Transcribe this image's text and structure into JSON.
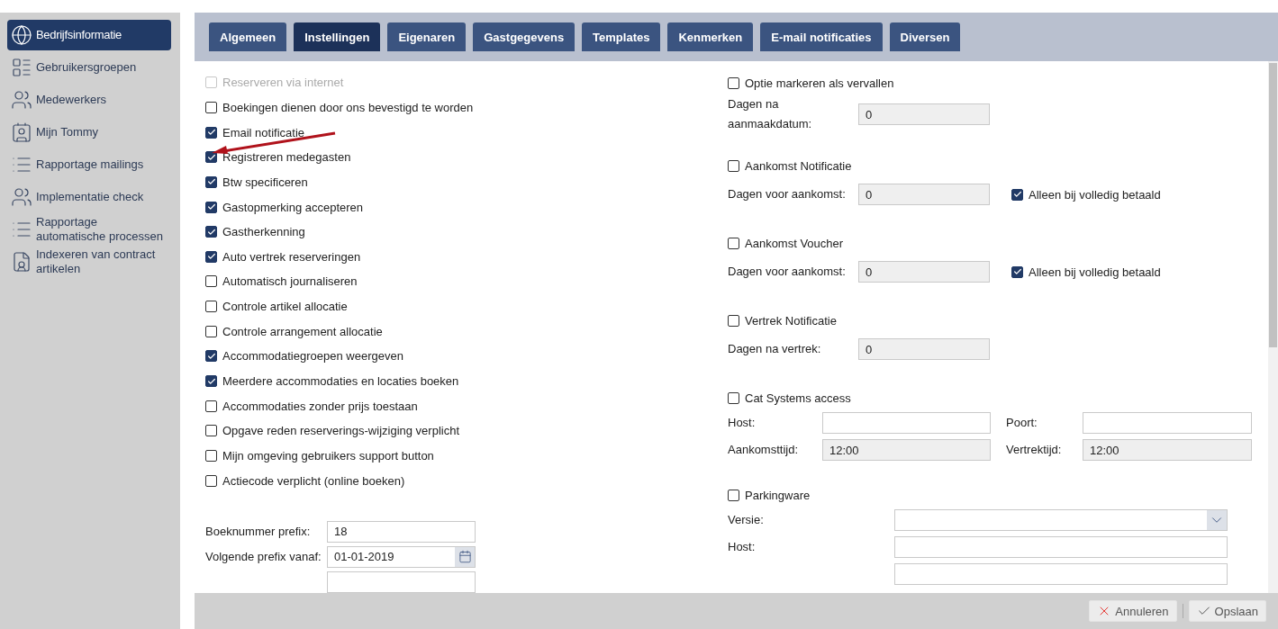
{
  "sidebar": {
    "items": [
      {
        "label": "Bedrijfsinformatie",
        "kind": "globe",
        "selected": true
      },
      {
        "label": "Gebruikersgroepen",
        "kind": "groups",
        "selected": false
      },
      {
        "label": "Medewerkers",
        "kind": "people",
        "selected": false
      },
      {
        "label": "Mijn Tommy",
        "kind": "card",
        "selected": false
      },
      {
        "label": "Rapportage mailings",
        "kind": "list",
        "selected": false
      },
      {
        "label": "Implementatie check",
        "kind": "people",
        "selected": false
      },
      {
        "label": "Rapportage automatische processen",
        "kind": "list",
        "selected": false
      },
      {
        "label": "Indexeren van contract artikelen",
        "kind": "document",
        "selected": false
      }
    ]
  },
  "tabs": [
    {
      "label": "Algemeen",
      "selected": false
    },
    {
      "label": "Instellingen",
      "selected": true
    },
    {
      "label": "Eigenaren",
      "selected": false
    },
    {
      "label": "Gastgegevens",
      "selected": false
    },
    {
      "label": "Templates",
      "selected": false
    },
    {
      "label": "Kenmerken",
      "selected": false
    },
    {
      "label": "E-mail notificaties",
      "selected": false
    },
    {
      "label": "Diversen",
      "selected": false
    }
  ],
  "settings": [
    {
      "label": "Reserveren via internet",
      "checked": false,
      "disabled": true
    },
    {
      "label": "Boekingen dienen door ons bevestigd te worden",
      "checked": false,
      "disabled": false
    },
    {
      "label": "Email notificatie",
      "checked": true,
      "disabled": false
    },
    {
      "label": "Registreren medegasten",
      "checked": true,
      "disabled": false
    },
    {
      "label": "Btw specificeren",
      "checked": true,
      "disabled": false
    },
    {
      "label": "Gastopmerking accepteren",
      "checked": true,
      "disabled": false
    },
    {
      "label": "Gastherkenning",
      "checked": true,
      "disabled": false
    },
    {
      "label": "Auto vertrek reserveringen",
      "checked": true,
      "disabled": false
    },
    {
      "label": "Automatisch journaliseren",
      "checked": false,
      "disabled": false
    },
    {
      "label": "Controle artikel allocatie",
      "checked": false,
      "disabled": false
    },
    {
      "label": "Controle arrangement allocatie",
      "checked": false,
      "disabled": false
    },
    {
      "label": "Accommodatiegroepen weergeven",
      "checked": true,
      "disabled": false
    },
    {
      "label": "Meerdere accommodaties en locaties boeken",
      "checked": true,
      "disabled": false
    },
    {
      "label": "Accommodaties zonder prijs toestaan",
      "checked": false,
      "disabled": false
    },
    {
      "label": "Opgave reden reserverings-wijziging verplicht",
      "checked": false,
      "disabled": false
    },
    {
      "label": "Mijn omgeving gebruikers support button",
      "checked": false,
      "disabled": false
    },
    {
      "label": "Actiecode verplicht (online boeken)",
      "checked": false,
      "disabled": false
    }
  ],
  "prefix_fields": [
    {
      "label": "Boeknummer prefix:",
      "value": "18",
      "kind": "text"
    },
    {
      "label": "Volgende prefix vanaf:",
      "value": "01-01-2019",
      "kind": "date"
    },
    {
      "kind": "text"
    }
  ],
  "sections": [
    {
      "label": "Optie markeren als vervallen",
      "checked": false,
      "kind": "days",
      "rows": [
        {
          "label": "Dagen na aanmaakdatum:",
          "value": "0"
        }
      ]
    },
    {
      "label": "Aankomst Notificatie",
      "checked": false,
      "kind": "days",
      "rows": [
        {
          "label": "Dagen voor aankomst:",
          "value": "0",
          "option": {
            "label": "Alleen bij volledig betaald",
            "checked": true
          }
        }
      ]
    },
    {
      "label": "Aankomst Voucher",
      "checked": false,
      "kind": "days",
      "rows": [
        {
          "label": "Dagen voor aankomst:",
          "value": "0",
          "option": {
            "label": "Alleen bij volledig betaald",
            "checked": true
          }
        }
      ]
    },
    {
      "label": "Vertrek Notificatie",
      "checked": false,
      "kind": "days",
      "rows": [
        {
          "label": "Dagen na vertrek:",
          "value": "0"
        }
      ]
    },
    {
      "label": "Cat Systems access",
      "checked": false,
      "kind": "access",
      "rows": [
        {
          "label": "Host:",
          "disabled": false,
          "second": {
            "label": "Poort:",
            "disabled": false
          }
        },
        {
          "label": "Aankomsttijd:",
          "value": "12:00",
          "disabled": true,
          "second": {
            "label": "Vertrektijd:",
            "value": "12:00",
            "disabled": true
          }
        }
      ]
    },
    {
      "label": "Parkingware",
      "checked": false,
      "kind": "parking",
      "rows": [
        {
          "label": "Versie:",
          "kind": "select"
        },
        {
          "label": "Host:",
          "kind": "text"
        },
        {
          "kind": "text"
        }
      ]
    }
  ],
  "footer": {
    "cancel": "Annuleren",
    "save": "Opslaan"
  }
}
